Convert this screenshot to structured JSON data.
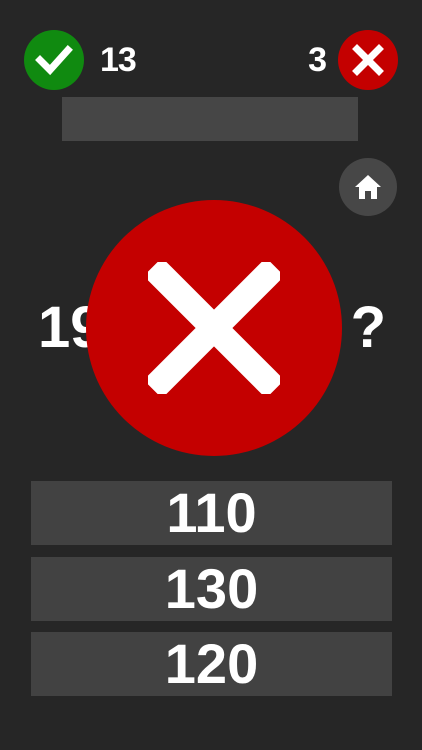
{
  "score": {
    "correct_count": "13",
    "wrong_count": "3"
  },
  "progress": {
    "fill_fraction": 0
  },
  "question": {
    "visible_left": "19",
    "visible_right": "?"
  },
  "result": {
    "state": "wrong",
    "icon": "x-mark-icon"
  },
  "answers": [
    {
      "label": "110"
    },
    {
      "label": "130"
    },
    {
      "label": "120"
    }
  ],
  "colors": {
    "background": "#262626",
    "correct": "#108a10",
    "wrong": "#c40000",
    "panel": "#424242",
    "home_button": "#474747",
    "text": "#ffffff"
  },
  "icons": {
    "correct_badge": "checkmark-icon",
    "wrong_badge": "x-mark-icon",
    "home": "home-icon"
  }
}
